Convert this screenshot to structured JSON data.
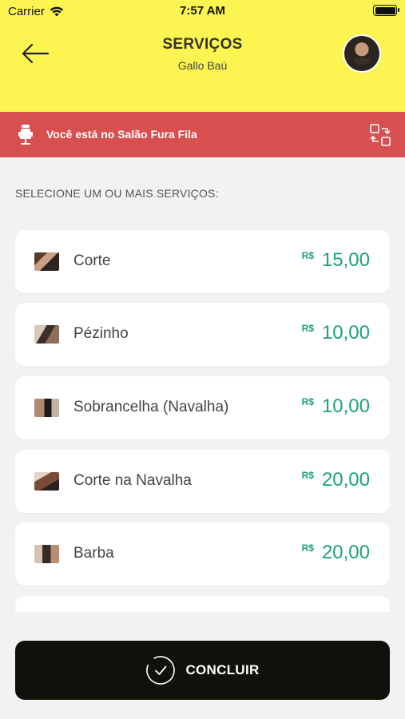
{
  "status_bar": {
    "carrier": "Carrier",
    "time": "7:57 AM"
  },
  "header": {
    "title": "SERVIÇOS",
    "subtitle": "Gallo Baú"
  },
  "banner": {
    "text": "Você está no Salão Fura Fila",
    "color": "#d84f4f"
  },
  "section_label": "SELECIONE UM OU MAIS SERVIÇOS:",
  "services": [
    {
      "name": "Corte",
      "currency": "R$",
      "price": "15,00"
    },
    {
      "name": "Pézinho",
      "currency": "R$",
      "price": "10,00"
    },
    {
      "name": "Sobrancelha (Navalha)",
      "currency": "R$",
      "price": "10,00"
    },
    {
      "name": "Corte na Navalha",
      "currency": "R$",
      "price": "20,00"
    },
    {
      "name": "Barba",
      "currency": "R$",
      "price": "20,00"
    }
  ],
  "finish_button": {
    "label": "CONCLUIR"
  },
  "colors": {
    "header_bg": "#fcf551",
    "accent_green": "#1aa46f",
    "button_bg": "#12100a"
  }
}
